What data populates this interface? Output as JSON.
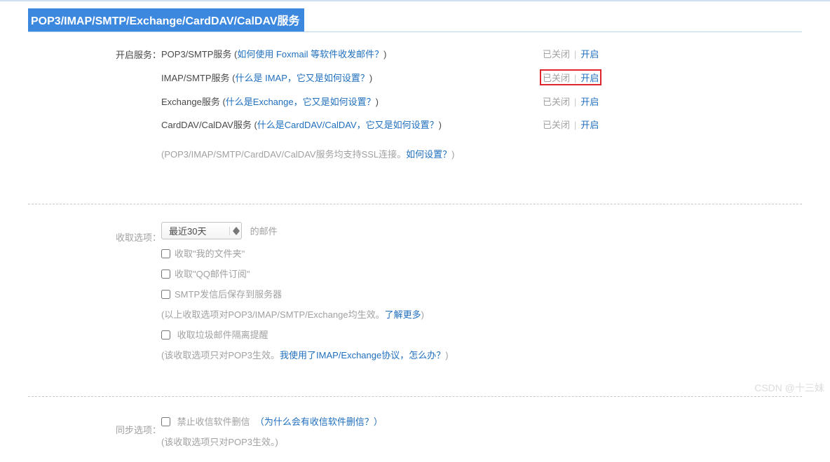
{
  "section": {
    "title": "POP3/IMAP/SMTP/Exchange/CardDAV/CalDAV服务"
  },
  "labels": {
    "enable_service": "开启服务：",
    "receive_options": "收取选项：",
    "sync_options": "同步选项："
  },
  "services": [
    {
      "name": "POP3/SMTP服务",
      "help_link": "如何使用 Foxmail 等软件收发邮件？",
      "status": "已关闭",
      "action": "开启",
      "highlight": false
    },
    {
      "name": "IMAP/SMTP服务",
      "help_link": "什么是 IMAP，它又是如何设置？",
      "status": "已关闭",
      "action": "开启",
      "highlight": true
    },
    {
      "name": "Exchange服务",
      "help_link": "什么是Exchange，它又是如何设置？",
      "status": "已关闭",
      "action": "开启",
      "highlight": false
    },
    {
      "name": "CardDAV/CalDAV服务",
      "help_link": "什么是CardDAV/CalDAV，它又是如何设置？",
      "status": "已关闭",
      "action": "开启",
      "highlight": false
    }
  ],
  "ssl_note": {
    "prefix": "(POP3/IMAP/SMTP/CardDAV/CalDAV服务均支持SSL连接。",
    "link": "如何设置？",
    "suffix": ")"
  },
  "receive": {
    "select_value": "最近30天",
    "select_suffix": "的邮件",
    "options": [
      {
        "label": "收取\"我的文件夹\""
      },
      {
        "label": "收取\"QQ邮件订阅\""
      },
      {
        "label": "SMTP发信后保存到服务器"
      }
    ],
    "note1_prefix": "(以上收取选项对POP3/IMAP/SMTP/Exchange均生效。",
    "note1_link": "了解更多",
    "note1_suffix": ")",
    "spam_option": "收取垃圾邮件隔离提醒",
    "note2_prefix": "(该收取选项只对POP3生效。",
    "note2_link": "我使用了IMAP/Exchange协议，怎么办？",
    "note2_suffix": ")"
  },
  "sync": {
    "forbid_delete": "禁止收信软件删信",
    "forbid_link": "（为什么会有收信软件删信？）",
    "note": "(该收取选项只对POP3生效。)"
  },
  "watermark": "CSDN @十三妹"
}
